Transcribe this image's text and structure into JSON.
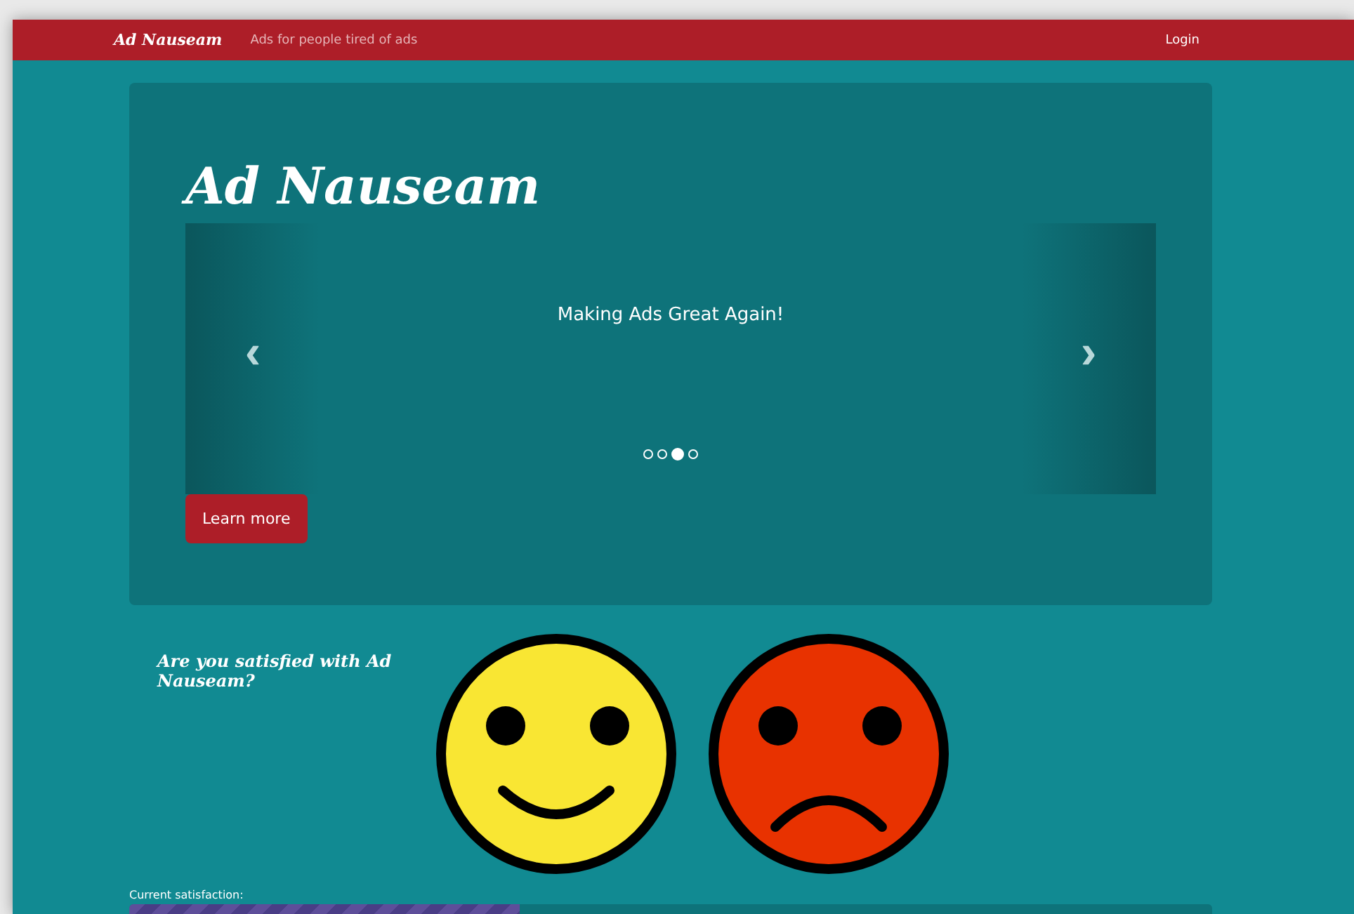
{
  "navbar": {
    "brand": "Ad Nauseam",
    "tagline": "Ads for people tired of ads",
    "login": "Login"
  },
  "hero": {
    "title": "Ad Nauseam",
    "carousel": {
      "caption": "Making Ads Great Again!",
      "prev": "‹",
      "next": "›",
      "slides": [
        {
          "selected": false
        },
        {
          "selected": false
        },
        {
          "selected": true
        },
        {
          "selected": false
        }
      ]
    },
    "button": "Learn more"
  },
  "survey": {
    "question": "Are you satisfied with Ad Nauseam?",
    "options": [
      {
        "kind": "happy",
        "color": "#f9e633"
      },
      {
        "kind": "sad",
        "color": "#e83200"
      }
    ]
  },
  "satisfaction": {
    "label": "Current satisfaction:",
    "level": 0.36
  }
}
